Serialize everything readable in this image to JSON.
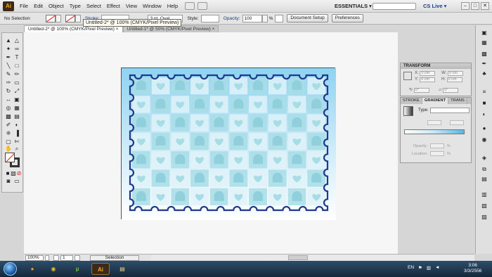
{
  "app": {
    "logo_text": "Ai"
  },
  "menubar": {
    "items": [
      "File",
      "Edit",
      "Object",
      "Type",
      "Select",
      "Effect",
      "View",
      "Window",
      "Help"
    ],
    "workspace": "ESSENTIALS ▾",
    "cslive": "CS Live ▾",
    "window_buttons": [
      "–",
      "□",
      "✕"
    ]
  },
  "control_bar": {
    "selection_label": "No Selection",
    "stroke_label": "Stroke:",
    "brush_label": "3 pt. Oval",
    "style_label": "Style:",
    "opacity_label": "Opacity:",
    "opacity_value": "100",
    "opacity_unit": "%",
    "doc_setup_button": "Document Setup",
    "preferences_button": "Preferences"
  },
  "tooltip": "Untitled-2* @ 100% (CMYK/Pixel Preview)",
  "tabs": [
    {
      "label": "Untitled-2* @ 100% (CMYK/Pixel Preview)",
      "close": "×"
    },
    {
      "label": "Untitled-1* @ 50% (CMYK/Pixel Preview)",
      "close": "×"
    }
  ],
  "statusbar": {
    "zoom": "100%",
    "page": "1",
    "mode": "Selection"
  },
  "transform_panel": {
    "title": "TRANSFORM",
    "x_label": "X:",
    "x_value": "0 cm",
    "y_label": "Y:",
    "y_value": "0 cm",
    "w_label": "W:",
    "w_value": "0 cm",
    "h_label": "H:",
    "h_value": "0 cm",
    "rot_value": "0°",
    "shear_value": "0°"
  },
  "gradient_panel": {
    "tabs": [
      "STROKE",
      "GRADIENT",
      "TRANS"
    ],
    "active_tab": "GRADIENT",
    "type_label": "Type:",
    "opacity_label": "Opacity:",
    "location_label": "Location:",
    "percent": "%"
  },
  "taskbar": {
    "apps": [
      {
        "name": "firefox",
        "glyph": "●"
      },
      {
        "name": "chrome",
        "glyph": "◉"
      },
      {
        "name": "utorrent",
        "glyph": "µ"
      },
      {
        "name": "illustrator",
        "glyph": "Ai"
      },
      {
        "name": "explorer",
        "glyph": "▤"
      }
    ],
    "language": "EN",
    "time": "3:06",
    "date": "3/3/2556"
  },
  "colors": {
    "stamp_border": "#1f3a8a",
    "stamp_bg_top": "#bfe6f8",
    "stamp_bg_bottom": "#ffffff",
    "tile_light": "#dff2f8",
    "tile_dark": "#a8dde6",
    "ai_orange": "#f6a623"
  }
}
